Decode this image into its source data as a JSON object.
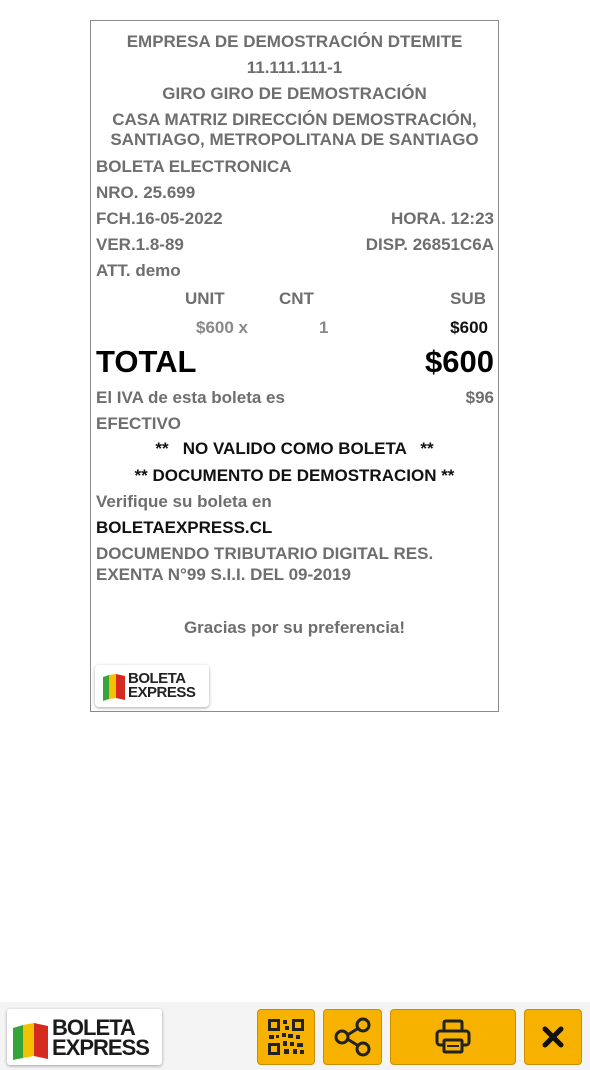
{
  "receipt": {
    "company": "EMPRESA DE DEMOSTRACIÓN DTEMITE",
    "rut": "11.111.111-1",
    "giro": "GIRO GIRO DE DEMOSTRACIÓN",
    "address_line1": "CASA MATRIZ DIRECCIÓN DEMOSTRACIÓN,",
    "address_line2": "SANTIAGO, METROPOLITANA DE SANTIAGO",
    "doc_type": "BOLETA ELECTRONICA",
    "number": "NRO.  25.699",
    "date": "FCH.16-05-2022",
    "time": "HORA.  12:23",
    "version": "VER.1.8-89",
    "device": "DISP.  26851C6A",
    "attendant": "ATT. demo",
    "columns": {
      "unit": "UNIT",
      "qty": "CNT",
      "sub": "SUB"
    },
    "items": [
      {
        "unit": "$600 x",
        "qty": "1",
        "sub": "$600"
      }
    ],
    "total_label": "TOTAL",
    "total_value": "$600",
    "iva_label": "El IVA de esta boleta es",
    "iva_value": "$96",
    "payment": "EFECTIVO",
    "notice1": "**   NO VALIDO COMO BOLETA   **",
    "notice2": "** DOCUMENTO DE DEMOSTRACION **",
    "verify_label": "Verifique su boleta en",
    "verify_url": "BOLETAEXPRESS.CL",
    "legal_line1": "DOCUMENDO TRIBUTARIO DIGITAL RES.",
    "legal_line2": "EXENTA N°99 S.I.I. DEL 09-2019",
    "thanks": "Gracias por su preferencia!",
    "logo_text_1": "BOLETA",
    "logo_text_2": "EXPRESS"
  },
  "toolbar": {
    "logo_text_1": "BOLETA",
    "logo_text_2": "EXPRESS",
    "buttons": [
      {
        "icon": "qr-code-icon"
      },
      {
        "icon": "share-icon"
      },
      {
        "icon": "printer-icon"
      },
      {
        "icon": "close-icon"
      }
    ]
  },
  "colors": {
    "accent": "#f7b200",
    "logo_green": "#37a33b",
    "logo_yellow": "#f2c200",
    "logo_red": "#d42a20",
    "text_gray": "#6e6e6e"
  }
}
